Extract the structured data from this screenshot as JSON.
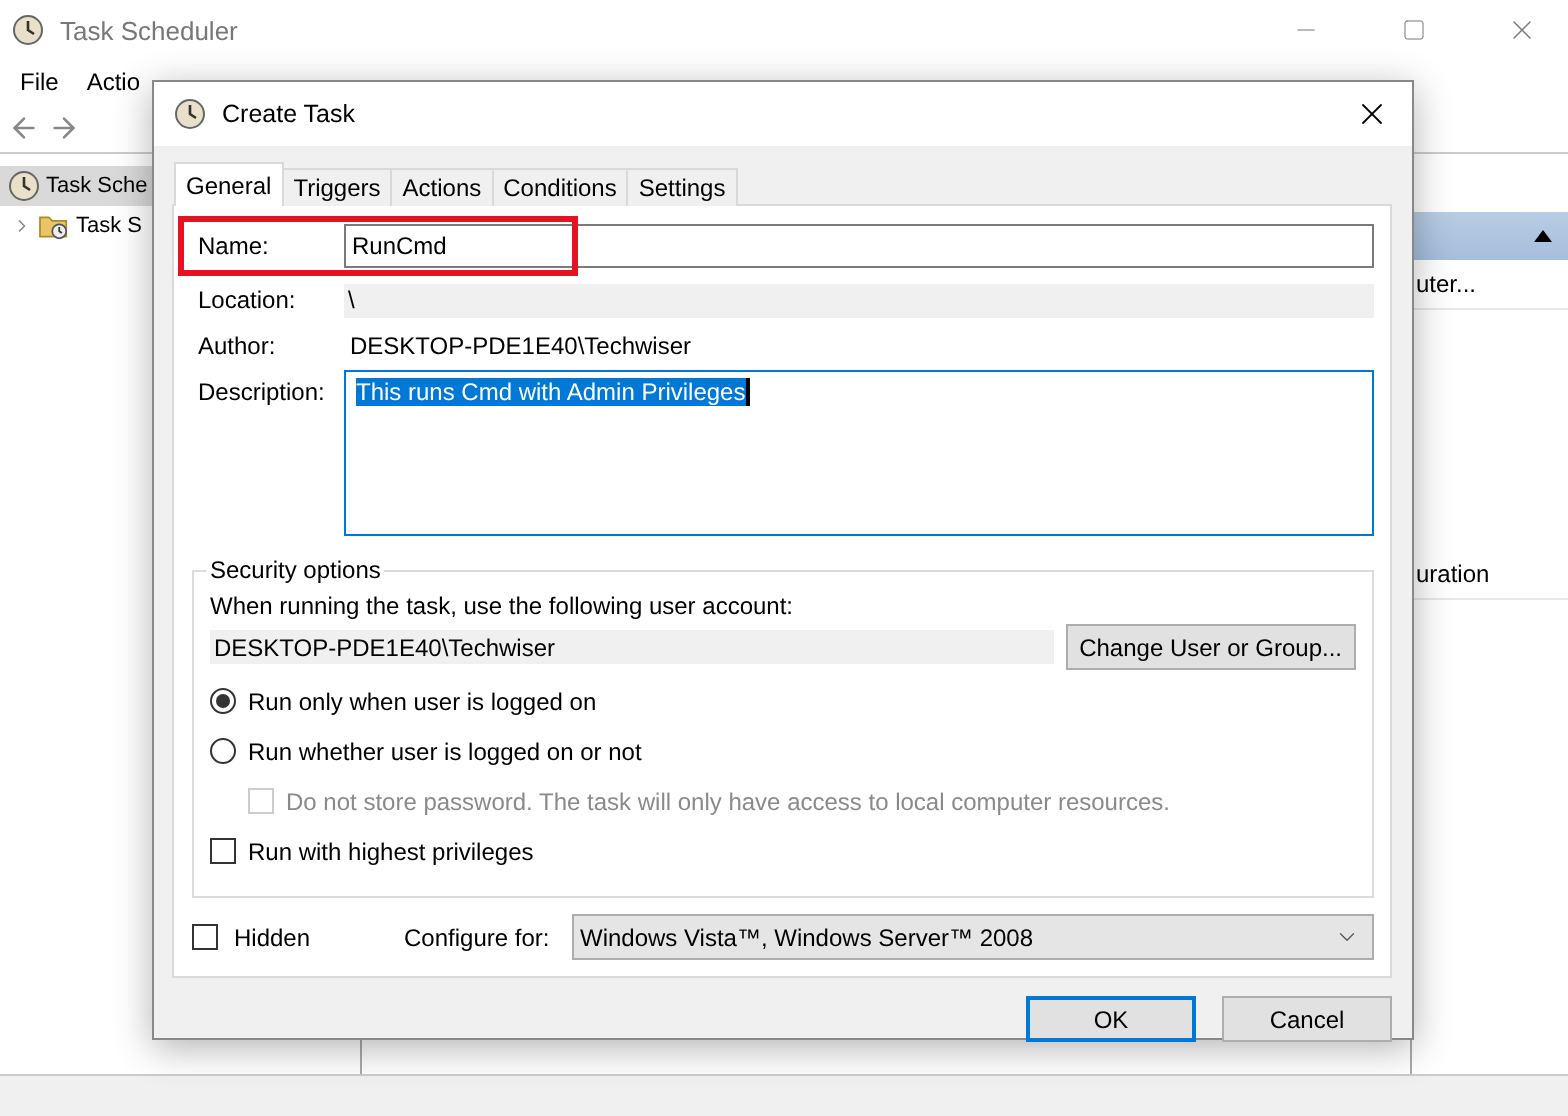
{
  "app": {
    "title": "Task Scheduler",
    "menu": [
      "File",
      "Actio"
    ],
    "tree": [
      {
        "label": "Task Sche",
        "selected": true,
        "children": [
          {
            "label": "Task S",
            "selected": false,
            "expanded": false
          }
        ]
      }
    ],
    "right_pane": [
      "uter...",
      "uration"
    ]
  },
  "dialog": {
    "title": "Create Task",
    "tabs": [
      {
        "label": "General",
        "selected": true
      },
      {
        "label": "Triggers",
        "selected": false
      },
      {
        "label": "Actions",
        "selected": false
      },
      {
        "label": "Conditions",
        "selected": false
      },
      {
        "label": "Settings",
        "selected": false
      }
    ],
    "name": {
      "label": "Name:",
      "value": "RunCmd",
      "highlighted": true
    },
    "location": {
      "label": "Location:",
      "value": "\\"
    },
    "author": {
      "label": "Author:",
      "value": "DESKTOP-PDE1E40\\Techwiser"
    },
    "description": {
      "label": "Description:",
      "value": "This runs Cmd with Admin Privileges",
      "selected_text": true
    },
    "security": {
      "title": "Security options",
      "account_label": "When running the task, use the following user account:",
      "account": "DESKTOP-PDE1E40\\Techwiser",
      "change_button": "Change User or Group...",
      "options": [
        {
          "kind": "radio",
          "label": "Run only when user is logged on",
          "checked": true,
          "disabled": false,
          "indented": false
        },
        {
          "kind": "radio",
          "label": "Run whether user is logged on or not",
          "checked": false,
          "disabled": false,
          "indented": false
        },
        {
          "kind": "checkbox",
          "label": "Do not store password.  The task will only have access to local computer resources.",
          "checked": false,
          "disabled": true,
          "indented": true
        },
        {
          "kind": "checkbox",
          "label": "Run with highest privileges",
          "checked": false,
          "disabled": false,
          "indented": false
        }
      ]
    },
    "hidden": {
      "label": "Hidden",
      "checked": false
    },
    "configure": {
      "label": "Configure for:",
      "value": "Windows Vista™, Windows Server™ 2008"
    },
    "buttons": [
      {
        "label": "OK",
        "default": true
      },
      {
        "label": "Cancel",
        "default": false
      }
    ]
  }
}
